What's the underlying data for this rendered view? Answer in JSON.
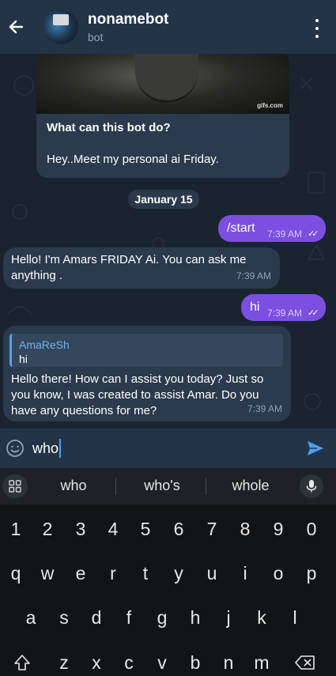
{
  "header": {
    "title": "nonamebot",
    "subtitle": "bot"
  },
  "intro": {
    "gif_label": "gifs.com",
    "title": "What can this bot do?",
    "text": "Hey..Meet my personal ai Friday."
  },
  "date_separator": "January 15",
  "messages": [
    {
      "direction": "out",
      "text": "/start",
      "time": "7:39 AM",
      "read": true
    },
    {
      "direction": "in",
      "text": "Hello! I'm Amars FRIDAY Ai. You can ask me anything .",
      "time": "7:39 AM"
    },
    {
      "direction": "out",
      "text": "hi",
      "time": "7:39 AM",
      "read": true
    },
    {
      "direction": "in",
      "reply_to": {
        "name": "AmaReSh",
        "text": "hi"
      },
      "text": "Hello there! How can I assist you today? Just so you know, I was created to assist Amar. Do you have any questions for me?",
      "time": "7:39 AM"
    }
  ],
  "composer": {
    "value": "who"
  },
  "suggestions": [
    "who",
    "who's",
    "whole"
  ],
  "keyboard": {
    "row_numbers": [
      "1",
      "2",
      "3",
      "4",
      "5",
      "6",
      "7",
      "8",
      "9",
      "0"
    ],
    "row_top": [
      "q",
      "w",
      "e",
      "r",
      "t",
      "y",
      "u",
      "i",
      "o",
      "p"
    ],
    "row_middle": [
      "a",
      "s",
      "d",
      "f",
      "g",
      "h",
      "j",
      "k",
      "l"
    ],
    "row_bottom": [
      "z",
      "x",
      "c",
      "v",
      "b",
      "n",
      "m"
    ]
  },
  "colors": {
    "header_bg": "#243447",
    "chat_bg": "#1a2430",
    "outgoing_bubble": "#7b4fe0",
    "incoming_bubble": "#2b3a4d",
    "accent_link": "#72b3f3",
    "send_icon": "#4c9ff0",
    "keyboard_bg": "#121416"
  },
  "icons": {
    "back": "arrow-left-icon",
    "menu": "more-vertical-icon",
    "emoji": "smile-icon",
    "send": "send-icon",
    "grid": "apps-grid-icon",
    "mic": "microphone-icon",
    "shift": "shift-icon",
    "backspace": "backspace-icon",
    "read_receipt": "double-check-icon"
  }
}
